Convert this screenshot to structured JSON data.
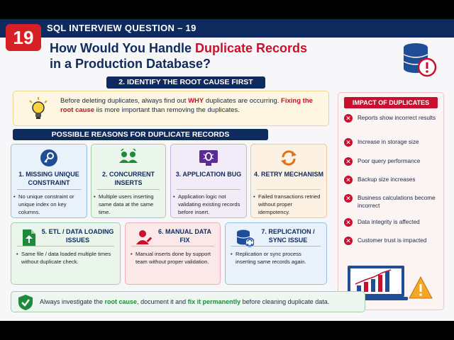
{
  "header": {
    "badge_number": "19",
    "topbar_title": "SQL INTERVIEW QUESTION – 19",
    "headline_part1": "How Would You Handle ",
    "headline_red": "Duplicate Records",
    "headline_part2": "in a Production Database?"
  },
  "root_cause": {
    "section_title": "2. IDENTIFY THE ROOT CAUSE FIRST",
    "text_a": "Before deleting duplicates, always find out ",
    "text_why": "WHY",
    "text_b": " duplicates are occurring. ",
    "text_fix": "Fixing the root cause",
    "text_c": " iis more important than removing the duplicates."
  },
  "reasons": {
    "section_title": "POSSIBLE REASONS FOR DUPLICATE RECORDS",
    "cards": [
      {
        "title": "1. MISSING UNIQUE CONSTRAINT",
        "bullet": "No unique constraint or unique index on key columns.",
        "icon": "key-icon"
      },
      {
        "title": "2. CONCURRENT INSERTS",
        "bullet": "Multiple users inserting same data at the same time.",
        "icon": "users-icon"
      },
      {
        "title": "3. APPLICATION BUG",
        "bullet": "Application logic not validating existing records before insert.",
        "icon": "bug-icon"
      },
      {
        "title": "4. RETRY MECHANISM",
        "bullet": "Failed transactions retried without proper idempotency.",
        "icon": "retry-icon"
      },
      {
        "title": "5. ETL / DATA LOADING ISSUES",
        "bullet": "Same file / data loaded multiple times without duplicate check.",
        "icon": "file-upload-icon"
      },
      {
        "title": "6. MANUAL DATA FIX",
        "bullet": "Manual inserts done by support team without proper validation.",
        "icon": "user-edit-icon"
      },
      {
        "title": "7. REPLICATION / SYNC ISSUE",
        "bullet": "Replication or sync process inserting same records again.",
        "icon": "sync-database-icon"
      }
    ]
  },
  "impact": {
    "title": "IMPACT OF DUPLICATES",
    "items": [
      "Reports show incorrect results",
      "Increase in storage size",
      "Poor query performance",
      "Backup size increases",
      "Business calculations become incorrect",
      "Data integrity is affected",
      "Customer trust is impacted"
    ]
  },
  "footer": {
    "text_a": "Always investigate the ",
    "text_root": "root cause",
    "text_b": ", document it and ",
    "text_fix": "fix it permanently",
    "text_c": " before cleaning duplicate data."
  },
  "colors": {
    "navy": "#0f2a5c",
    "red": "#c8102e",
    "green": "#1e8a3a"
  }
}
